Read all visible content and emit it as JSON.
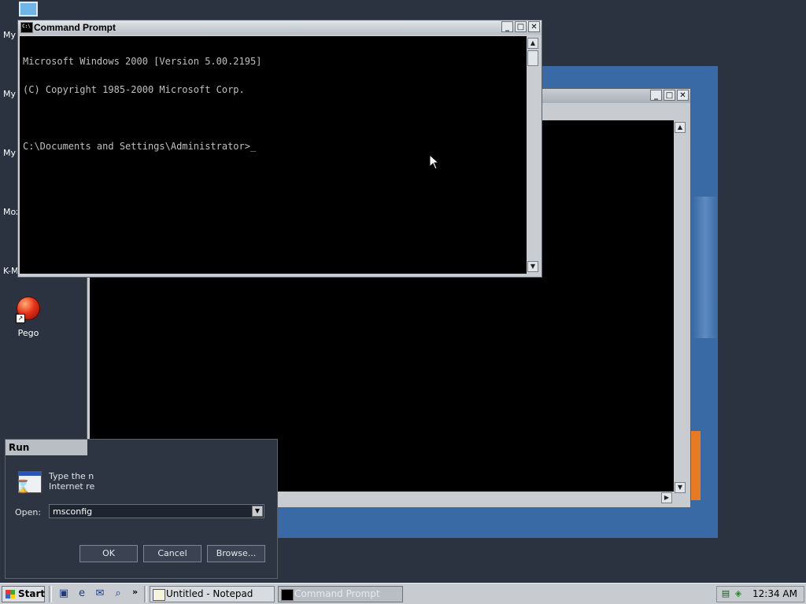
{
  "desktop": {
    "icons": [
      {
        "label": "My"
      },
      {
        "label": "My D"
      },
      {
        "label": "My"
      },
      {
        "label": "Moz"
      },
      {
        "label": "K-M"
      }
    ],
    "pego_label": "Pego"
  },
  "cmd_window": {
    "title": "Command Prompt",
    "lines": [
      "Microsoft Windows 2000 [Version 5.00.2195]",
      "(C) Copyright 1985-2000 Microsoft Corp.",
      "",
      "C:\\Documents and Settings\\Administrator>_"
    ]
  },
  "bg_window": {
    "title": ""
  },
  "run_dialog": {
    "title": "Run",
    "description_line1": "Type the n",
    "description_line2": "Internet re",
    "open_label": "Open:",
    "open_value": "msconfig",
    "ok_label": "OK",
    "cancel_label": "Cancel",
    "browse_label": "Browse..."
  },
  "taskbar": {
    "start_label": "Start",
    "chevron": "»",
    "tasks": [
      {
        "label": "Untitled - Notepad"
      },
      {
        "label": "Command Prompt"
      }
    ],
    "clock": "12:34 AM"
  },
  "colors": {
    "desktop": "#2b3341",
    "console_bg": "#000000",
    "console_fg": "#c0c0c0",
    "accent_blue": "#3a6aa6",
    "accent_orange": "#e87a22"
  }
}
